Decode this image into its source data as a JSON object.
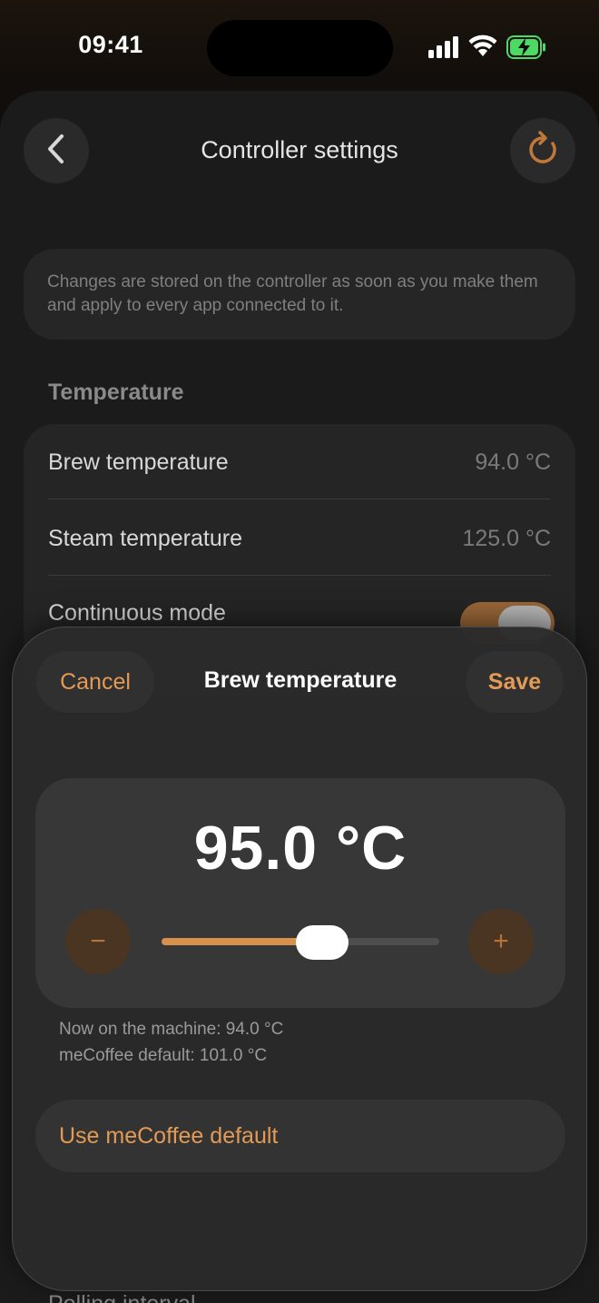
{
  "status_bar": {
    "time": "09:41",
    "icons": [
      "cellular-signal-icon",
      "wifi-icon",
      "battery-charging-icon"
    ]
  },
  "nav": {
    "title": "Controller settings",
    "back_icon": "chevron-left-icon",
    "refresh_icon": "refresh-icon"
  },
  "info": {
    "text": "Changes are stored on the controller as soon as you make them and apply to every app connected to it."
  },
  "temperature_section": {
    "header": "Temperature",
    "rows": [
      {
        "label": "Brew temperature",
        "value": "94.0 °C"
      },
      {
        "label": "Steam temperature",
        "value": "125.0 °C"
      },
      {
        "label": "Continuous mode",
        "toggle_on": true
      }
    ]
  },
  "background_footer_text": "Polling interval",
  "modal": {
    "cancel_label": "Cancel",
    "title": "Brew temperature",
    "save_label": "Save",
    "current_value": "95.0 °C",
    "slider_fraction": 0.58,
    "decrement_label": "−",
    "increment_label": "+",
    "machine_value_text": "Now on the machine: 94.0 °C",
    "default_value_text": "meCoffee default: 101.0 °C",
    "use_default_label": "Use meCoffee default"
  },
  "colors": {
    "accent": "#e39a55",
    "slider_fill": "#d8914c",
    "toggle_on": "#9a6738",
    "battery": "#4cd964"
  }
}
